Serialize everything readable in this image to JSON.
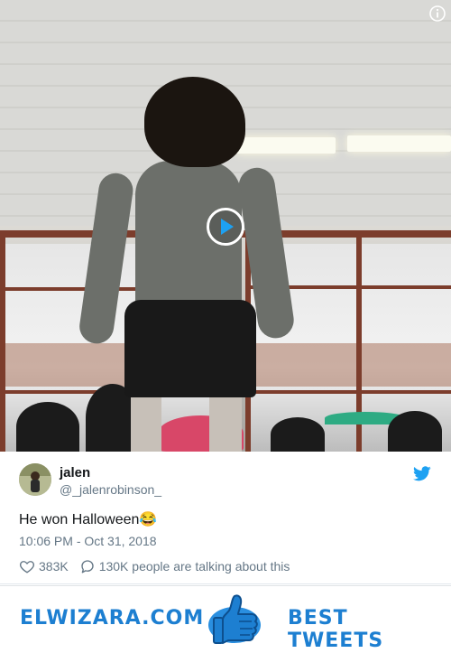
{
  "tweet": {
    "display_name": "jalen",
    "handle": "@_jalenrobinson_",
    "text": "He won Halloween😂",
    "timestamp": "10:06 PM - Oct 31, 2018",
    "likes": "383K",
    "talking": "130K people are talking about this"
  },
  "media": {
    "play_icon": "play-icon",
    "info_icon": "info-icon"
  },
  "banner": {
    "left_text": "ELWIZARA.COM",
    "right_text": "BEST TWEETS",
    "icon": "thumbs-up-icon"
  },
  "colors": {
    "accent": "#1d7fd1",
    "twitter_blue": "#1da1f2",
    "text_primary": "#14171a",
    "text_secondary": "#657786"
  }
}
